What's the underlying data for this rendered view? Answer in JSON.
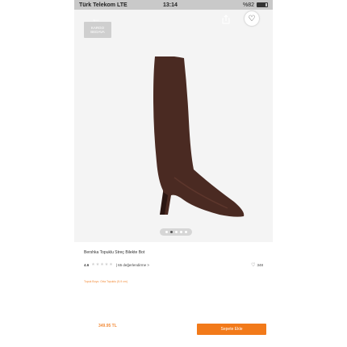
{
  "status_bar": {
    "carrier": "Türk Telekom LTE",
    "time": "13:14",
    "battery": "%82",
    "battery_level": 0.82
  },
  "header": {
    "back_icon": "←",
    "share_icon": "share-icon",
    "favorite_icon": "♡"
  },
  "badge": {
    "line1": "KARGO",
    "line2": "BEDAVA"
  },
  "gallery": {
    "dot_count": 5,
    "active_index": 1
  },
  "product": {
    "title": "Bershka Topuklu Streç Bilekte Bot",
    "rating": "4.6",
    "stars": "★★★★★",
    "reviews": "| 65 değerlendirme >",
    "favorite_count": "348",
    "size_note": "Topuk Boyu: Orta Topuklu (5-9 cm)"
  },
  "footer": {
    "price": "349.95 TL",
    "add_to_cart": "Sepete Ekle"
  },
  "colors": {
    "accent": "#f27a1a",
    "boot": "#4a2a22"
  }
}
